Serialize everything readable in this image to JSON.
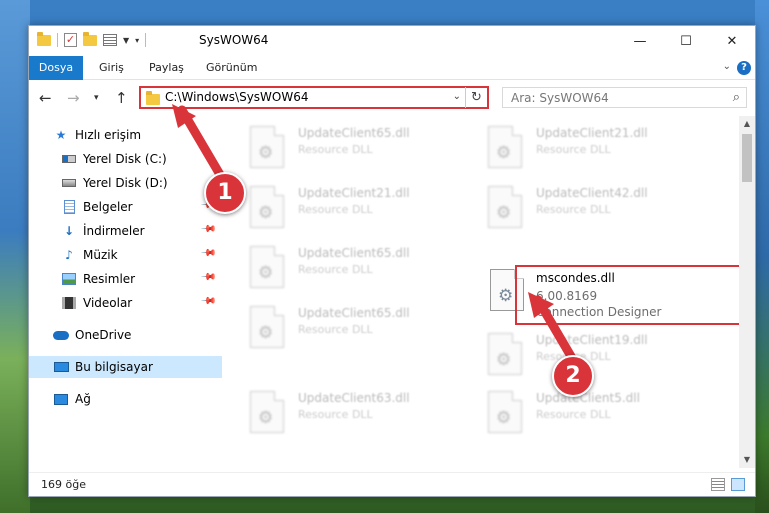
{
  "window": {
    "title": "SysWOW64",
    "controls": {
      "minimize": "—",
      "maximize": "☐",
      "close": "✕"
    }
  },
  "ribbon": {
    "tabs": [
      {
        "label": "Dosya"
      },
      {
        "label": "Giriş"
      },
      {
        "label": "Paylaş"
      },
      {
        "label": "Görünüm"
      }
    ],
    "help": "?"
  },
  "nav": {
    "address": "C:\\Windows\\SysWOW64",
    "search_placeholder": "Ara: SysWOW64"
  },
  "sidebar": {
    "items": [
      {
        "label": "Hızlı erişim",
        "icon": "star-icon",
        "pinned": false
      },
      {
        "label": "Yerel Disk (C:)",
        "icon": "windows-drive-icon",
        "pinned": false
      },
      {
        "label": "Yerel Disk (D:)",
        "icon": "drive-icon",
        "pinned": false
      },
      {
        "label": "Belgeler",
        "icon": "documents-icon",
        "pinned": true
      },
      {
        "label": "İndirmeler",
        "icon": "downloads-icon",
        "pinned": true
      },
      {
        "label": "Müzik",
        "icon": "music-icon",
        "pinned": true
      },
      {
        "label": "Resimler",
        "icon": "pictures-icon",
        "pinned": true
      },
      {
        "label": "Videolar",
        "icon": "videos-icon",
        "pinned": true
      },
      {
        "label": "OneDrive",
        "icon": "onedrive-icon",
        "pinned": false
      },
      {
        "label": "Bu bilgisayar",
        "icon": "this-pc-icon",
        "pinned": false
      },
      {
        "label": "Ağ",
        "icon": "network-icon",
        "pinned": false
      }
    ]
  },
  "files": [
    {
      "name": "UpdateClient65.dll",
      "desc": "Resource DLL"
    },
    {
      "name": "UpdateClient21.dll",
      "desc": "Resource DLL"
    },
    {
      "name": "UpdateClient21.dll",
      "desc": "Resource DLL"
    },
    {
      "name": "UpdateClient42.dll",
      "desc": "Resource DLL"
    },
    {
      "name": "UpdateClient65.dll",
      "desc": "Resource DLL"
    },
    {
      "name": "mscondes.dll",
      "version": "6.00.8169",
      "desc": "Connection Designer"
    },
    {
      "name": "UpdateClient65.dll",
      "desc": "Resource DLL"
    },
    {
      "name": "UpdateClient19.dll",
      "desc": "Resource DLL"
    },
    {
      "name": "UpdateClient63.dll",
      "desc": "Resource DLL"
    },
    {
      "name": "UpdateClient5.dll",
      "desc": "Resource DLL"
    }
  ],
  "status": {
    "count": "169 öğe"
  },
  "annotations": {
    "step1": "1",
    "step2": "2",
    "color": "#d9343a"
  }
}
